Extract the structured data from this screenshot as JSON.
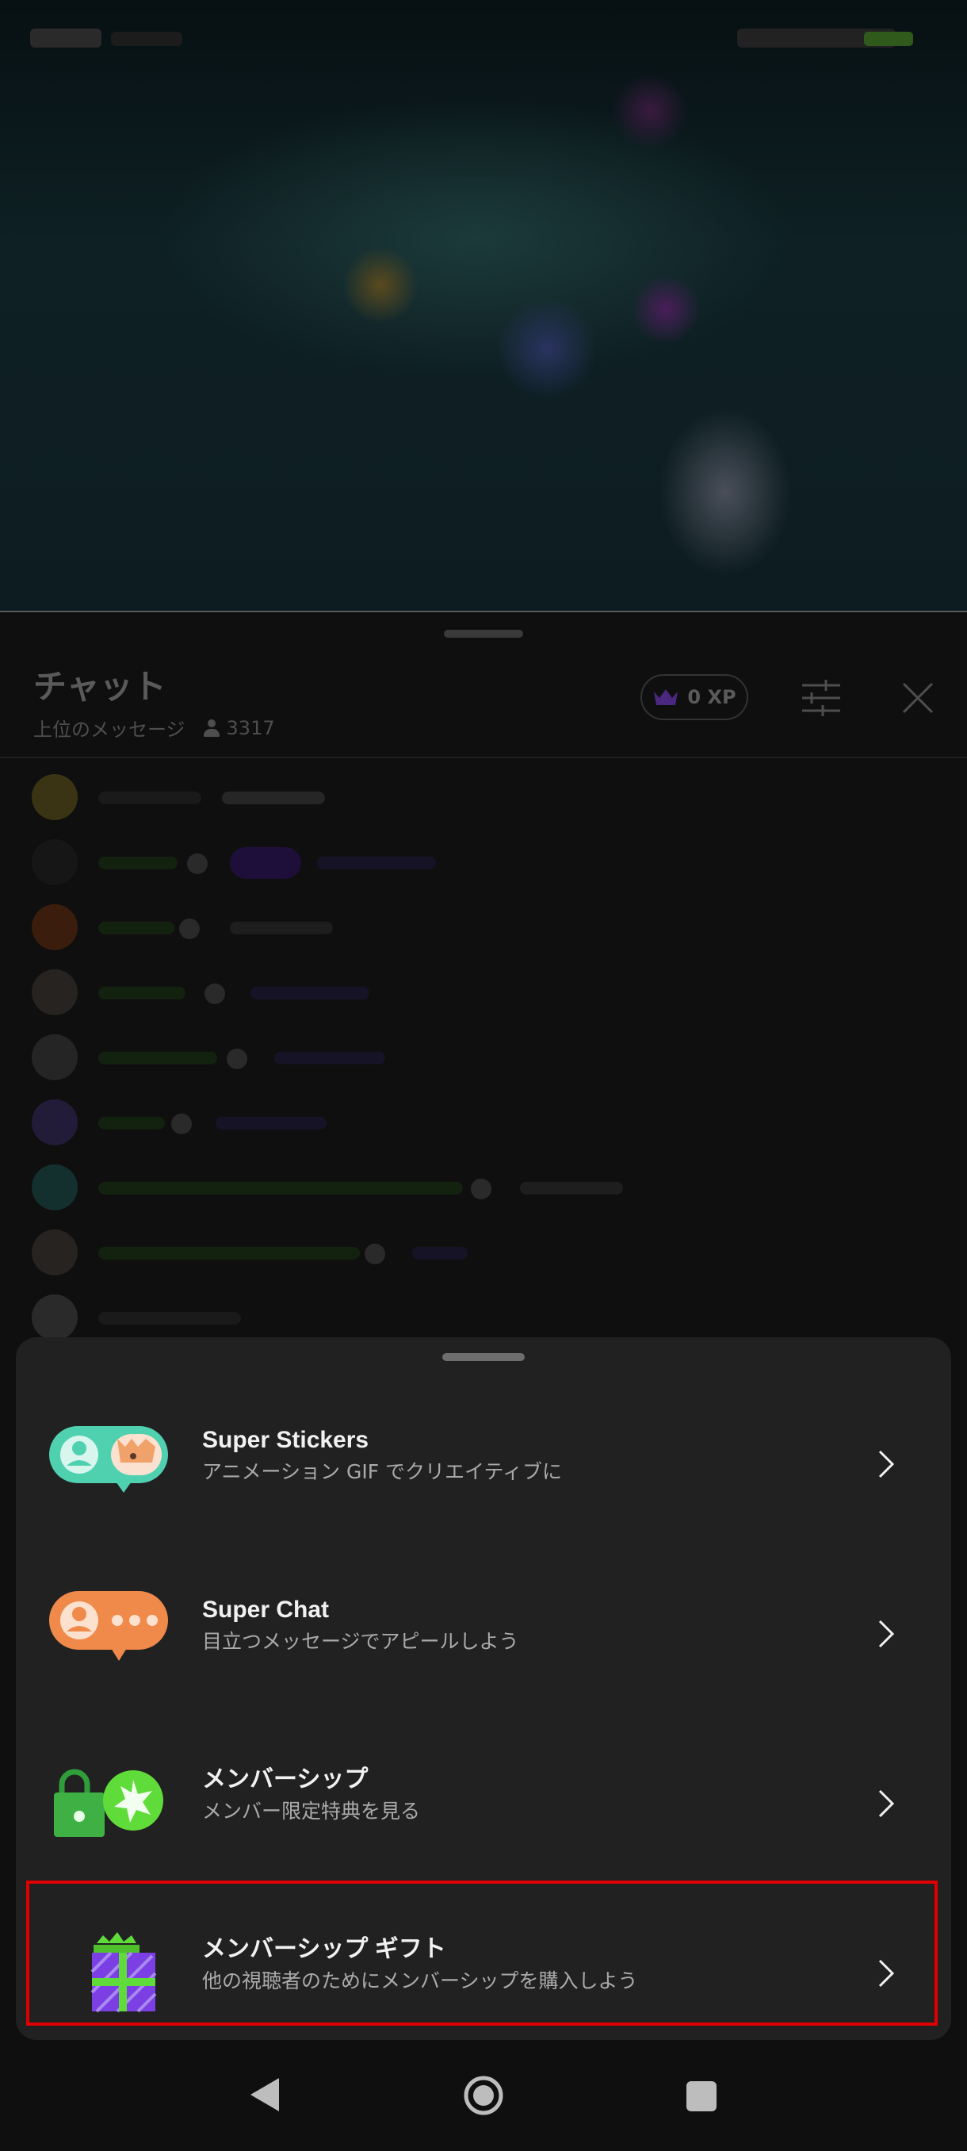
{
  "chat": {
    "title": "チャット",
    "mode_label": "上位のメッセージ",
    "viewer_count": "3317",
    "xp_label": "0 XP"
  },
  "sheet": {
    "items": [
      {
        "title": "Super Stickers",
        "description": "アニメーション GIF でクリエイティブに",
        "icon": "super-stickers-icon"
      },
      {
        "title": "Super Chat",
        "description": "目立つメッセージでアピールしよう",
        "icon": "super-chat-icon"
      },
      {
        "title": "メンバーシップ",
        "description": "メンバー限定特典を見る",
        "icon": "membership-icon"
      },
      {
        "title": "メンバーシップ ギフト",
        "description": "他の視聴者のためにメンバーシップを購入しよう",
        "icon": "gift-membership-icon"
      }
    ],
    "highlighted_item": "メンバーシップ ギフト"
  },
  "colors": {
    "sheet_background": "#212121",
    "highlight_border": "#e00000",
    "super_stickers": "#4fd1b0",
    "super_chat": "#f08a4b",
    "membership": "#3fbf3f",
    "gift": "#7b3fe4",
    "xp_crown": "#5b2ca3"
  }
}
